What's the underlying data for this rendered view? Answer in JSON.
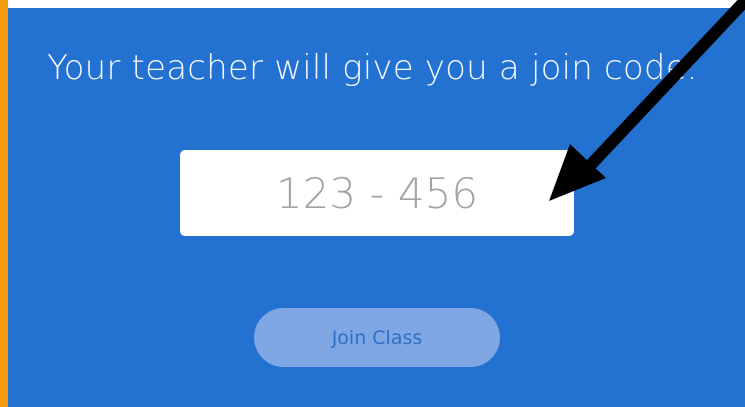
{
  "prompt": {
    "text": "Your teacher will give you a join code."
  },
  "code_input": {
    "placeholder": "123 - 456",
    "value": ""
  },
  "join_button": {
    "label": "Join Class"
  },
  "annotation": {
    "icon": "arrow-icon",
    "color": "#000000"
  },
  "colors": {
    "panel": "#2371d1",
    "accent": "#f39c12",
    "button": "#7ea7e4"
  }
}
